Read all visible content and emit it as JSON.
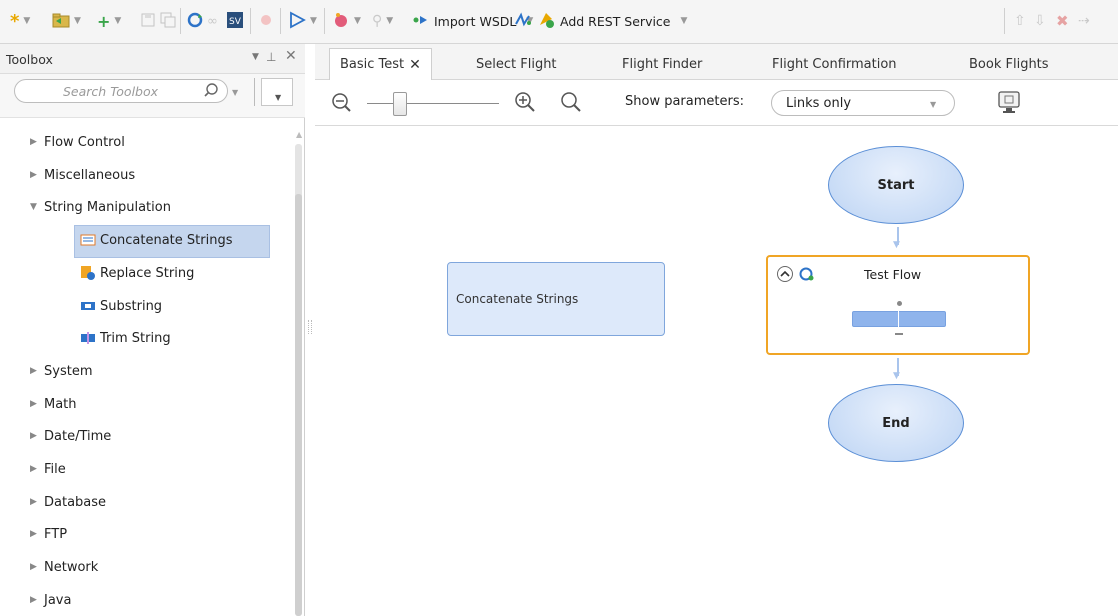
{
  "toolbar": {
    "import_wsdl_label": "Import WSDL",
    "add_rest_label": "Add REST Service",
    "accent_green": "#3aa54a",
    "accent_blue": "#2d73c8"
  },
  "toolbox": {
    "title": "Toolbox",
    "search_placeholder": "Search Toolbox",
    "items": [
      {
        "label": "Flow Control",
        "expanded": false,
        "icon": "none"
      },
      {
        "label": "Miscellaneous",
        "expanded": false,
        "icon": "none"
      },
      {
        "label": "String Manipulation",
        "expanded": true,
        "icon": "none"
      },
      {
        "label": "Concatenate Strings",
        "child": true,
        "selected": true,
        "icon": "concatenate-icon"
      },
      {
        "label": "Replace String",
        "child": true,
        "icon": "replace-icon"
      },
      {
        "label": "Substring",
        "child": true,
        "icon": "substring-icon"
      },
      {
        "label": "Trim String",
        "child": true,
        "icon": "trim-icon"
      },
      {
        "label": "System",
        "expanded": false,
        "icon": "none"
      },
      {
        "label": "Math",
        "expanded": false,
        "icon": "none"
      },
      {
        "label": "Date/Time",
        "expanded": false,
        "icon": "none"
      },
      {
        "label": "File",
        "expanded": false,
        "icon": "none"
      },
      {
        "label": "Database",
        "expanded": false,
        "icon": "none"
      },
      {
        "label": "FTP",
        "expanded": false,
        "icon": "none"
      },
      {
        "label": "Network",
        "expanded": false,
        "icon": "none"
      },
      {
        "label": "Java",
        "expanded": false,
        "icon": "none"
      }
    ]
  },
  "tabs": [
    {
      "label": "Basic Test",
      "active": true,
      "closable": true
    },
    {
      "label": "Select Flight"
    },
    {
      "label": "Flight Finder"
    },
    {
      "label": "Flight Confirmation"
    },
    {
      "label": "Book Flights"
    }
  ],
  "zoom": {
    "level": 0.2,
    "show_parameters_label": "Show parameters:",
    "show_parameters_value": "Links only"
  },
  "canvas": {
    "start_label": "Start",
    "end_label": "End",
    "concat_node_label": "Concatenate Strings",
    "test_flow_label": "Test Flow",
    "highlight_color": "#f0a525"
  }
}
